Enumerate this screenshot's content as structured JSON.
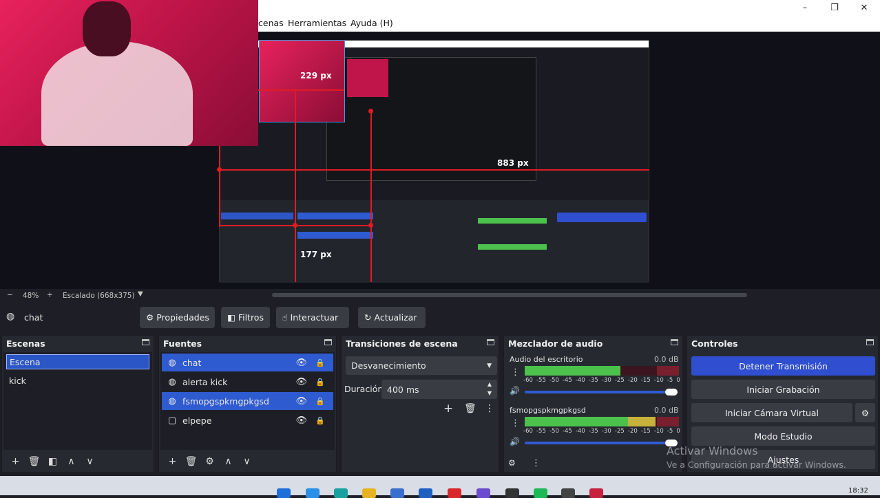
{
  "window": {
    "controls": [
      "–",
      "❐",
      "✕"
    ]
  },
  "menubar": {
    "items": [
      "cenas",
      "Herramientas",
      "Ayuda (H)"
    ]
  },
  "preview": {
    "labels": [
      "229 px",
      "883 px",
      "177 px"
    ]
  },
  "scalebar": {
    "minus": "−",
    "zoom": "48%",
    "plus": "+",
    "scaling": "Escalado (668x375)"
  },
  "source_toolbar": {
    "current_source": "chat",
    "buttons": [
      {
        "icon": "gear-icon",
        "glyph": "⚙",
        "label": "Propiedades"
      },
      {
        "icon": "filter-icon",
        "glyph": "◧",
        "label": "Filtros"
      },
      {
        "icon": "hand-icon",
        "glyph": "☝",
        "label": "Interactuar"
      },
      {
        "icon": "refresh-icon",
        "glyph": "↻",
        "label": "Actualizar"
      }
    ]
  },
  "scenes": {
    "title": "Escenas",
    "items": [
      "Escena",
      "kick"
    ],
    "selected": 0
  },
  "sources": {
    "title": "Fuentes",
    "items": [
      {
        "label": "chat",
        "icon": "globe-icon"
      },
      {
        "label": "alerta kick",
        "icon": "globe-icon"
      },
      {
        "label": "fsmopgspkmgpkgsd",
        "icon": "globe-icon"
      },
      {
        "label": "elpepe",
        "icon": "monitor-icon"
      }
    ],
    "selected": [
      0,
      2
    ]
  },
  "transitions": {
    "title": "Transiciones de escena",
    "type": "Desvanecimiento",
    "duration_label": "Duración",
    "duration_value": "400 ms"
  },
  "mixer": {
    "title": "Mezclador de audio",
    "channels": [
      {
        "name": "Audio del escritorio",
        "db": "0.0 dB",
        "level": 0.62
      },
      {
        "name": "fsmopgspkmgpkgsd",
        "db": "0.0 dB",
        "level": 0.78
      }
    ],
    "ticks": [
      "-60",
      "-55",
      "-50",
      "-45",
      "-40",
      "-35",
      "-30",
      "-25",
      "-20",
      "-15",
      "-10",
      "-5",
      "0"
    ]
  },
  "controls": {
    "title": "Controles",
    "stop_stream": "Detener Transmisión",
    "start_recording": "Iniciar Grabación",
    "virtual_camera": "Iniciar Cámara Virtual",
    "studio_mode": "Modo Estudio",
    "settings": "Ajustes"
  },
  "watermark": {
    "title": "Activar Windows",
    "subtitle": "Ve a Configuración para activar Windows."
  },
  "taskbar": {
    "time": "18:32"
  }
}
